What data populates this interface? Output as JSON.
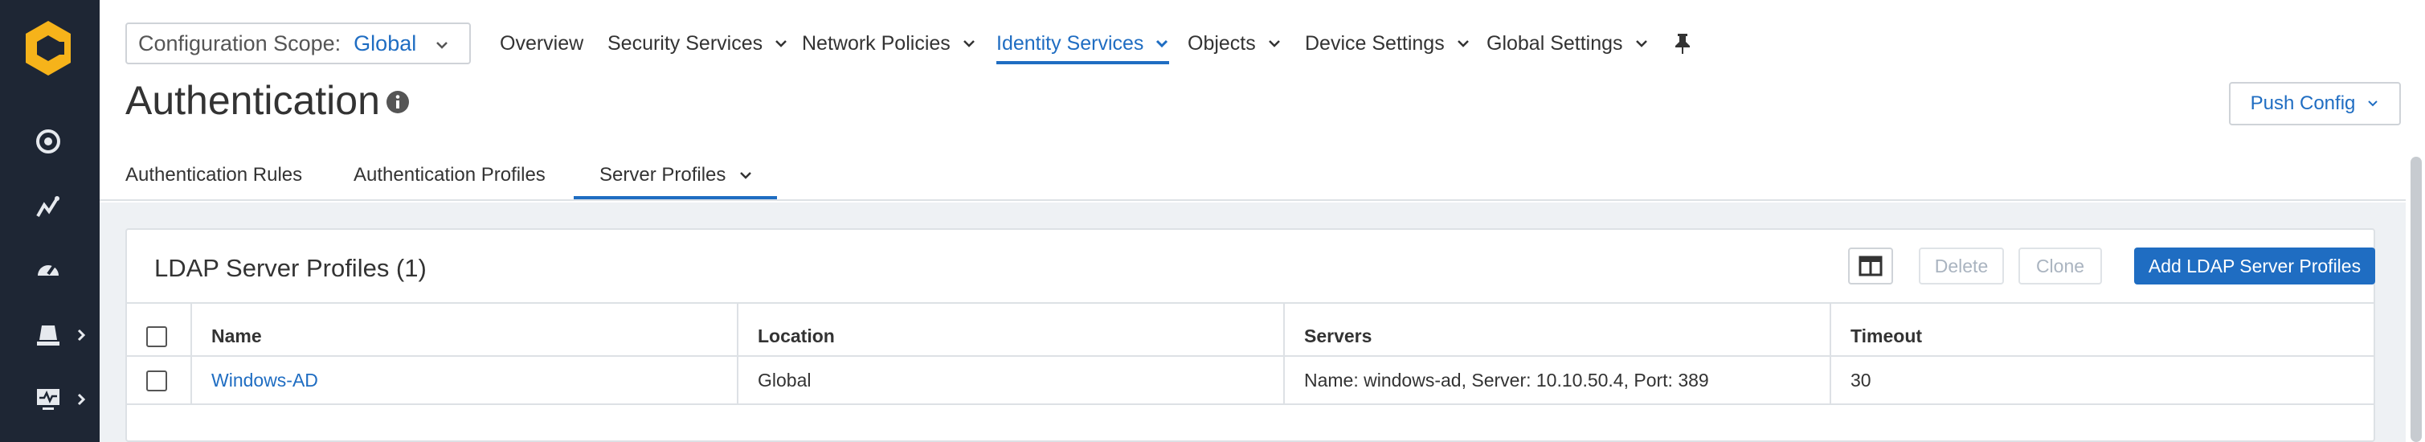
{
  "scope": {
    "label": "Configuration Scope:",
    "value": "Global"
  },
  "nav": {
    "items": [
      "Overview",
      "Security Services",
      "Network Policies",
      "Identity Services",
      "Objects",
      "Device Settings",
      "Global Settings"
    ],
    "active": "Identity Services"
  },
  "page": {
    "title": "Authentication",
    "push_label": "Push Config"
  },
  "tabs": [
    "Authentication Rules",
    "Authentication Profiles",
    "Server Profiles"
  ],
  "card": {
    "title": "LDAP Server Profiles (1)",
    "delete_label": "Delete",
    "clone_label": "Clone",
    "add_label": "Add LDAP Server Profiles"
  },
  "table": {
    "headers": [
      "Name",
      "Location",
      "Servers",
      "Timeout"
    ],
    "rows": [
      {
        "name": "Windows-AD",
        "location": "Global",
        "servers": "Name: windows-ad, Server: 10.10.50.4, Port: 389",
        "timeout": "30"
      }
    ]
  },
  "colors": {
    "sidebar": "#1e2634",
    "accent": "#1f6dc2",
    "logo": "#f6b31a"
  },
  "icons": [
    "logo-icon",
    "dashboard-icon",
    "activity-icon",
    "gauge-icon",
    "policies-icon",
    "monitor-icon",
    "info-icon",
    "pin-icon",
    "columns-icon"
  ]
}
